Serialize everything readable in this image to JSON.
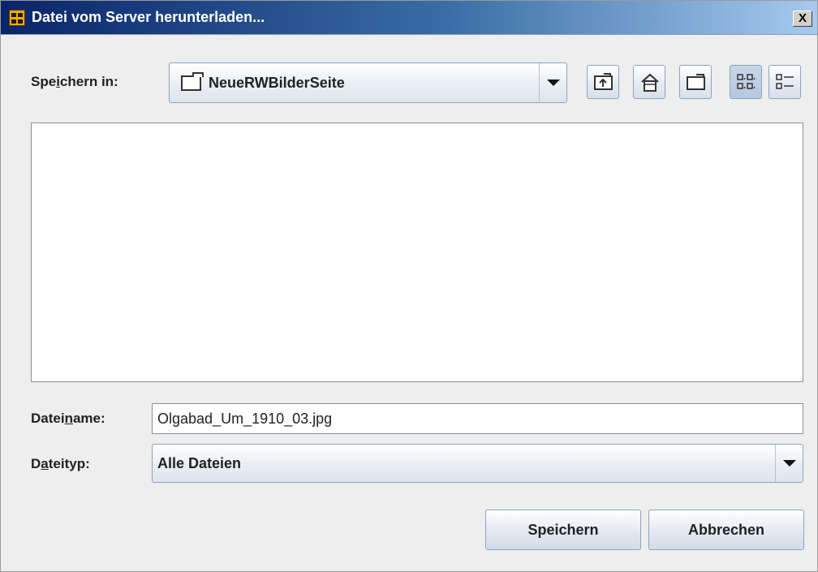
{
  "window": {
    "title": "Datei vom Server herunterladen...",
    "close_symbol": "X",
    "icon": "app-window-icon"
  },
  "look_in": {
    "label_pre": "Spe",
    "label_mnemonic": "i",
    "label_post": "chern in:",
    "value": "NeueRWBilderSeite",
    "icon": "folder-icon"
  },
  "toolbar": {
    "buttons": [
      {
        "name": "up-one-level-button",
        "icon": "folder-up-icon"
      },
      {
        "name": "home-button",
        "icon": "home-icon"
      },
      {
        "name": "new-folder-button",
        "icon": "new-folder-icon"
      },
      {
        "name": "list-view-button",
        "icon": "list-view-icon",
        "pressed": true
      },
      {
        "name": "details-view-button",
        "icon": "details-view-icon",
        "pressed": false
      }
    ]
  },
  "filename": {
    "label_pre": "Datei",
    "label_mnemonic": "n",
    "label_post": "ame:",
    "value": "Olgabad_Um_1910_03.jpg"
  },
  "filetype": {
    "label_pre": "D",
    "label_mnemonic": "a",
    "label_post": "teityp:",
    "value": "Alle Dateien"
  },
  "actions": {
    "save_label": "Speichern",
    "cancel_label": "Abbrechen"
  },
  "colors": {
    "titlebar_start": "#0a246a",
    "titlebar_end": "#a6caf0",
    "dialog_bg": "#eeeeee"
  }
}
